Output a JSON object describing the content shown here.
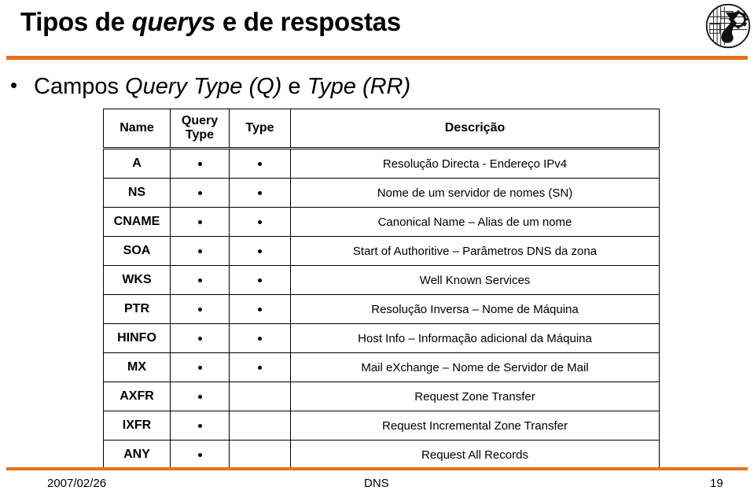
{
  "slide": {
    "title_parts": [
      {
        "text": "Tipos de ",
        "italic": false
      },
      {
        "text": "querys",
        "italic": true
      },
      {
        "text": " e de respostas",
        "italic": false
      }
    ],
    "title_plain": "Tipos de querys e de respostas",
    "accent_color": "#E8701A",
    "bullet_parts": [
      {
        "text": "Campos ",
        "italic": false
      },
      {
        "text": "Query Type (Q)",
        "italic": true
      },
      {
        "text": " e ",
        "italic": false
      },
      {
        "text": "Type (RR)",
        "italic": true
      }
    ],
    "bullet_plain": "Campos Query Type (Q) e Type (RR)"
  },
  "table": {
    "headers": {
      "name": "Name",
      "query_type": "Query Type",
      "query_type_line1": "Query",
      "query_type_line2": "Type",
      "type": "Type",
      "description": "Descrição"
    },
    "rows": [
      {
        "name": "A",
        "query_type": true,
        "type": true,
        "description": "Resolução Directa - Endereço IPv4"
      },
      {
        "name": "NS",
        "query_type": true,
        "type": true,
        "description": "Nome de um servidor de nomes (SN)"
      },
      {
        "name": "CNAME",
        "query_type": true,
        "type": true,
        "description": "Canonical Name – Alias de um nome"
      },
      {
        "name": "SOA",
        "query_type": true,
        "type": true,
        "description": "Start of Authoritive – Parâmetros DNS da zona"
      },
      {
        "name": "WKS",
        "query_type": true,
        "type": true,
        "description": "Well Known Services"
      },
      {
        "name": "PTR",
        "query_type": true,
        "type": true,
        "description": "Resolução Inversa – Nome de Máquina"
      },
      {
        "name": "HINFO",
        "query_type": true,
        "type": true,
        "description": "Host Info – Informação adicional da Máquina"
      },
      {
        "name": "MX",
        "query_type": true,
        "type": true,
        "description": "Mail eXchange – Nome de Servidor de Mail"
      },
      {
        "name": "AXFR",
        "query_type": true,
        "type": false,
        "description": "Request Zone Transfer"
      },
      {
        "name": "IXFR",
        "query_type": true,
        "type": false,
        "description": "Request Incremental Zone Transfer"
      },
      {
        "name": "ANY",
        "query_type": true,
        "type": false,
        "description": "Request All Records"
      }
    ]
  },
  "footer": {
    "date": "2007/02/26",
    "title": "DNS",
    "page": "19"
  },
  "logo": {
    "name": "institution-emblem"
  }
}
